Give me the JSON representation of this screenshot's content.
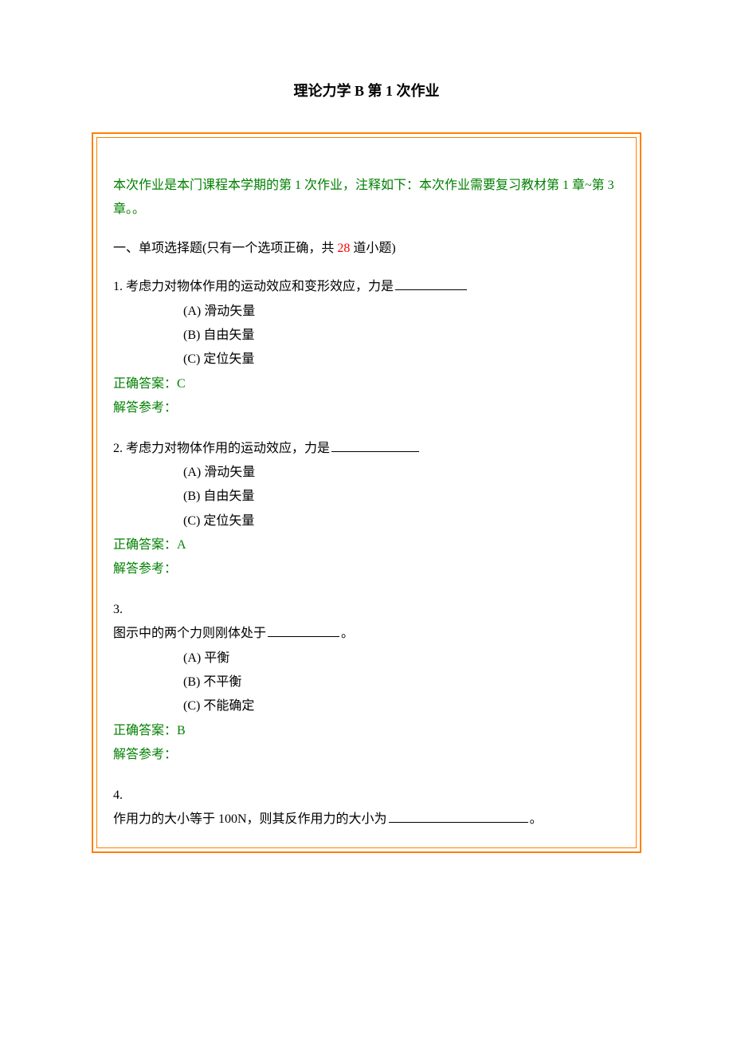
{
  "title": "理论力学 B 第 1 次作业",
  "note": "本次作业是本门课程本学期的第 1 次作业，注释如下：本次作业需要复习教材第 1 章~第 3 章。。",
  "sectionHead": {
    "prefix": "一、单项选择题(只有一个选项正确，共 ",
    "count": "28",
    "suffix": " 道小题)"
  },
  "labels": {
    "correct": "正确答案：",
    "ref": "解答参考："
  },
  "q1": {
    "num": "1.    ",
    "text": "考虑力对物体作用的运动效应和变形效应，力是",
    "opts": {
      "a": "(A)   滑动矢量",
      "b": "(B)   自由矢量",
      "c": "(C)   定位矢量"
    },
    "ans": "C"
  },
  "q2": {
    "num": "2.   ",
    "text": "考虑力对物体作用的运动效应，力是",
    "opts": {
      "a": "(A)   滑动矢量",
      "b": "(B)   自由矢量",
      "c": "(C)   定位矢量"
    },
    "ans": "A"
  },
  "q3": {
    "num": "3.",
    "text1": "图示中的两个力则刚体处于",
    "text2": "。",
    "opts": {
      "a": "(A)   平衡",
      "b": "(B)   不平衡",
      "c": "(C)   不能确定"
    },
    "ans": "B"
  },
  "q4": {
    "num": "4.",
    "text1": "作用力的大小等于 100N，则其反作用力的大小为",
    "text2": "。"
  }
}
